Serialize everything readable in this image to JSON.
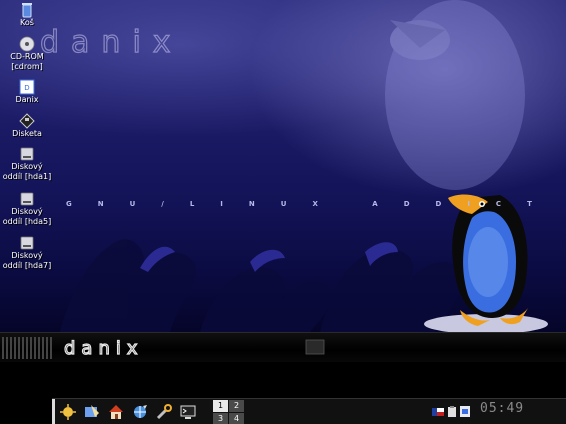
{
  "desktop": {
    "wallpaper_title": "danix",
    "wallpaper_tagline": "GNU/LINUX ADDICT",
    "icons": [
      {
        "label": "Koš",
        "icon": "trash-icon"
      },
      {
        "label": "CD-ROM\n[cdrom]",
        "icon": "cdrom-icon"
      },
      {
        "label": "Danix",
        "icon": "danix-icon"
      },
      {
        "label": "Disketa",
        "icon": "floppy-icon"
      },
      {
        "label": "Diskový\noddíl [hda1]",
        "icon": "harddisk-icon"
      },
      {
        "label": "Diskový\noddíl [hda5]",
        "icon": "harddisk-icon"
      },
      {
        "label": "Diskový\noddíl [hda7]",
        "icon": "harddisk-icon"
      }
    ]
  },
  "banner": {
    "logo_text": "danix"
  },
  "taskbar": {
    "launchers": [
      "kde-menu-icon",
      "konqueror-icon",
      "home-icon",
      "network-icon",
      "control-center-icon",
      "terminal-icon"
    ],
    "pager": [
      "1",
      "2",
      "3",
      "4"
    ],
    "active_desktop": "1",
    "tray": [
      "keyboard-layout-icon",
      "clipboard-icon",
      "kmix-icon"
    ],
    "clock": "05:49"
  },
  "colors": {
    "wallpaper_top": "#2a2a7a",
    "wallpaper_bottom": "#05052a",
    "tux_body": "#3a6ee0",
    "taskbar_bg": "#111111"
  }
}
